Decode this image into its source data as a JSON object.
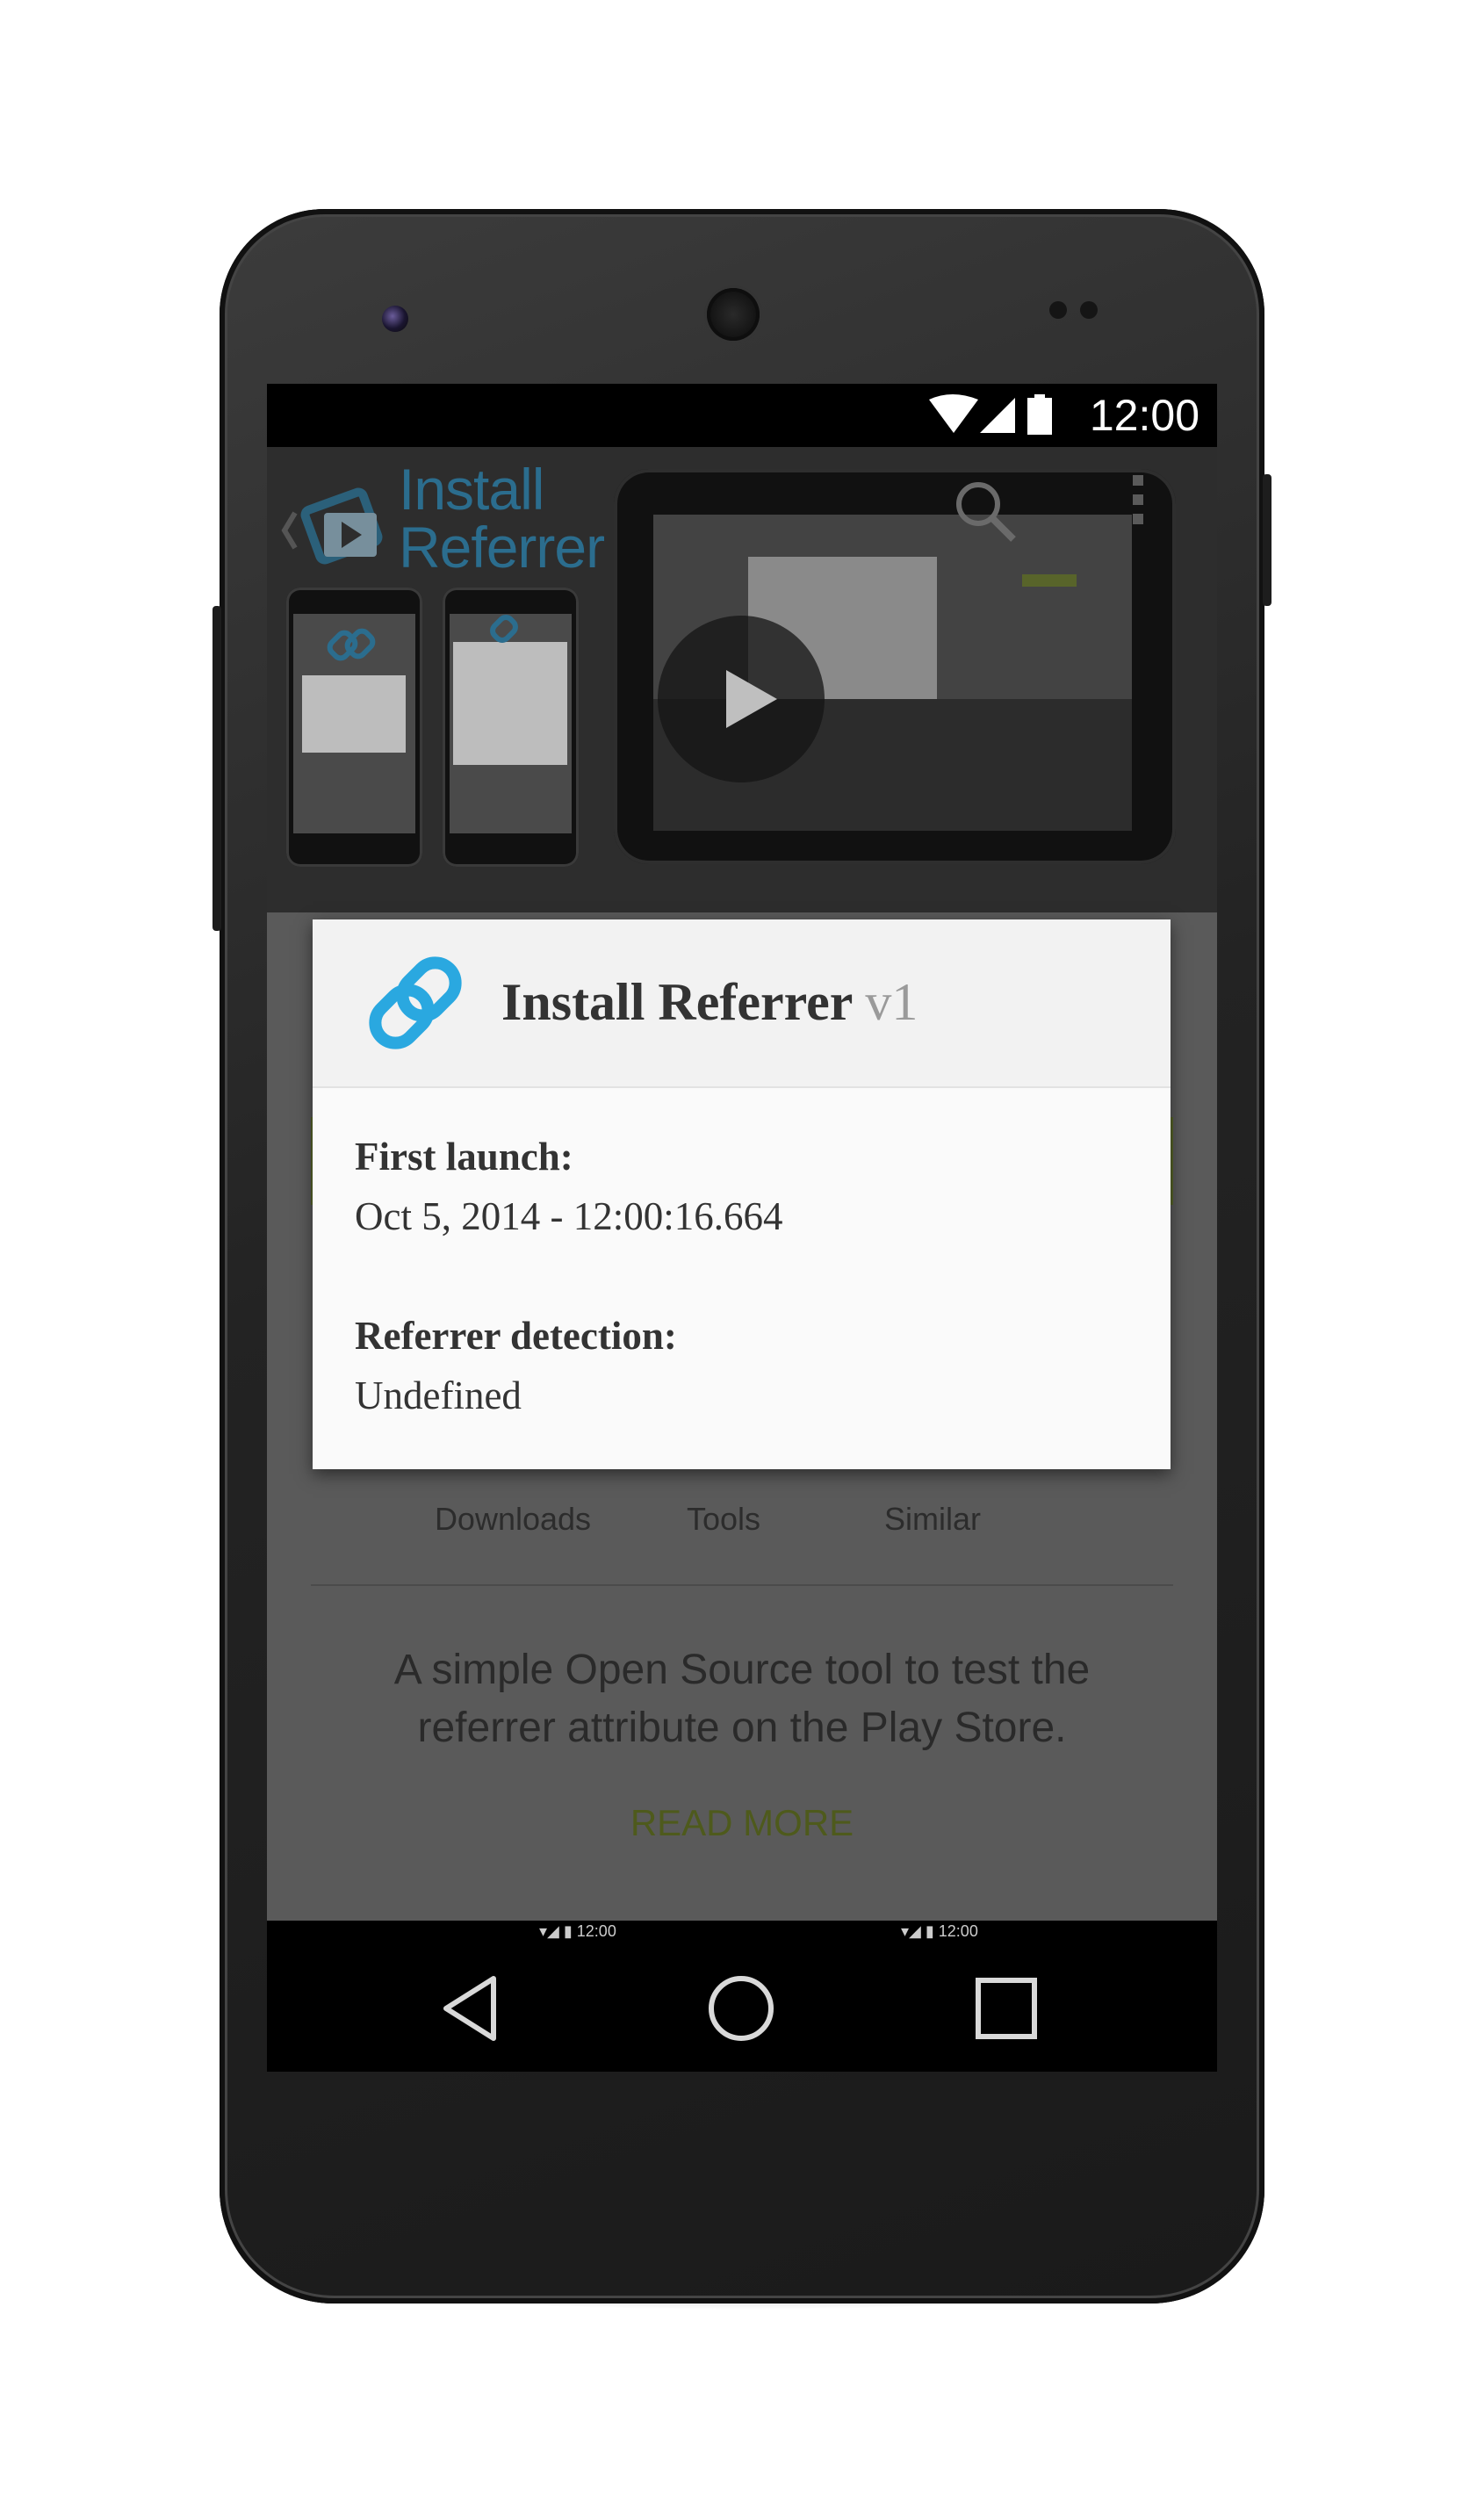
{
  "status_bar": {
    "time": "12:00",
    "icons": [
      "wifi-icon",
      "cell-signal-icon",
      "battery-icon"
    ]
  },
  "banner": {
    "logo_text_line1": "Install",
    "logo_text_line2": "Referrer",
    "icons": [
      "back-chevron-icon",
      "search-icon",
      "overflow-menu-icon",
      "play-icon"
    ]
  },
  "dialog": {
    "app_name": "Install Referrer",
    "version": "v1",
    "fields": [
      {
        "label": "First launch:",
        "value": "Oct 5, 2014 - 12:00:16.664"
      },
      {
        "label": "Referrer detection:",
        "value": "Undefined"
      }
    ]
  },
  "categories": [
    "Downloads",
    "Tools",
    "Similar"
  ],
  "description": "A simple Open Source tool to test the referrer attribute on the Play Store.",
  "read_more": "READ MORE",
  "nav_bar": {
    "icons": [
      "back-icon",
      "home-icon",
      "recents-icon"
    ]
  },
  "colors": {
    "accent_link": "#2aa8e0",
    "read_more": "#4e5a1c",
    "dim_overlay": "#5e5e5e"
  }
}
